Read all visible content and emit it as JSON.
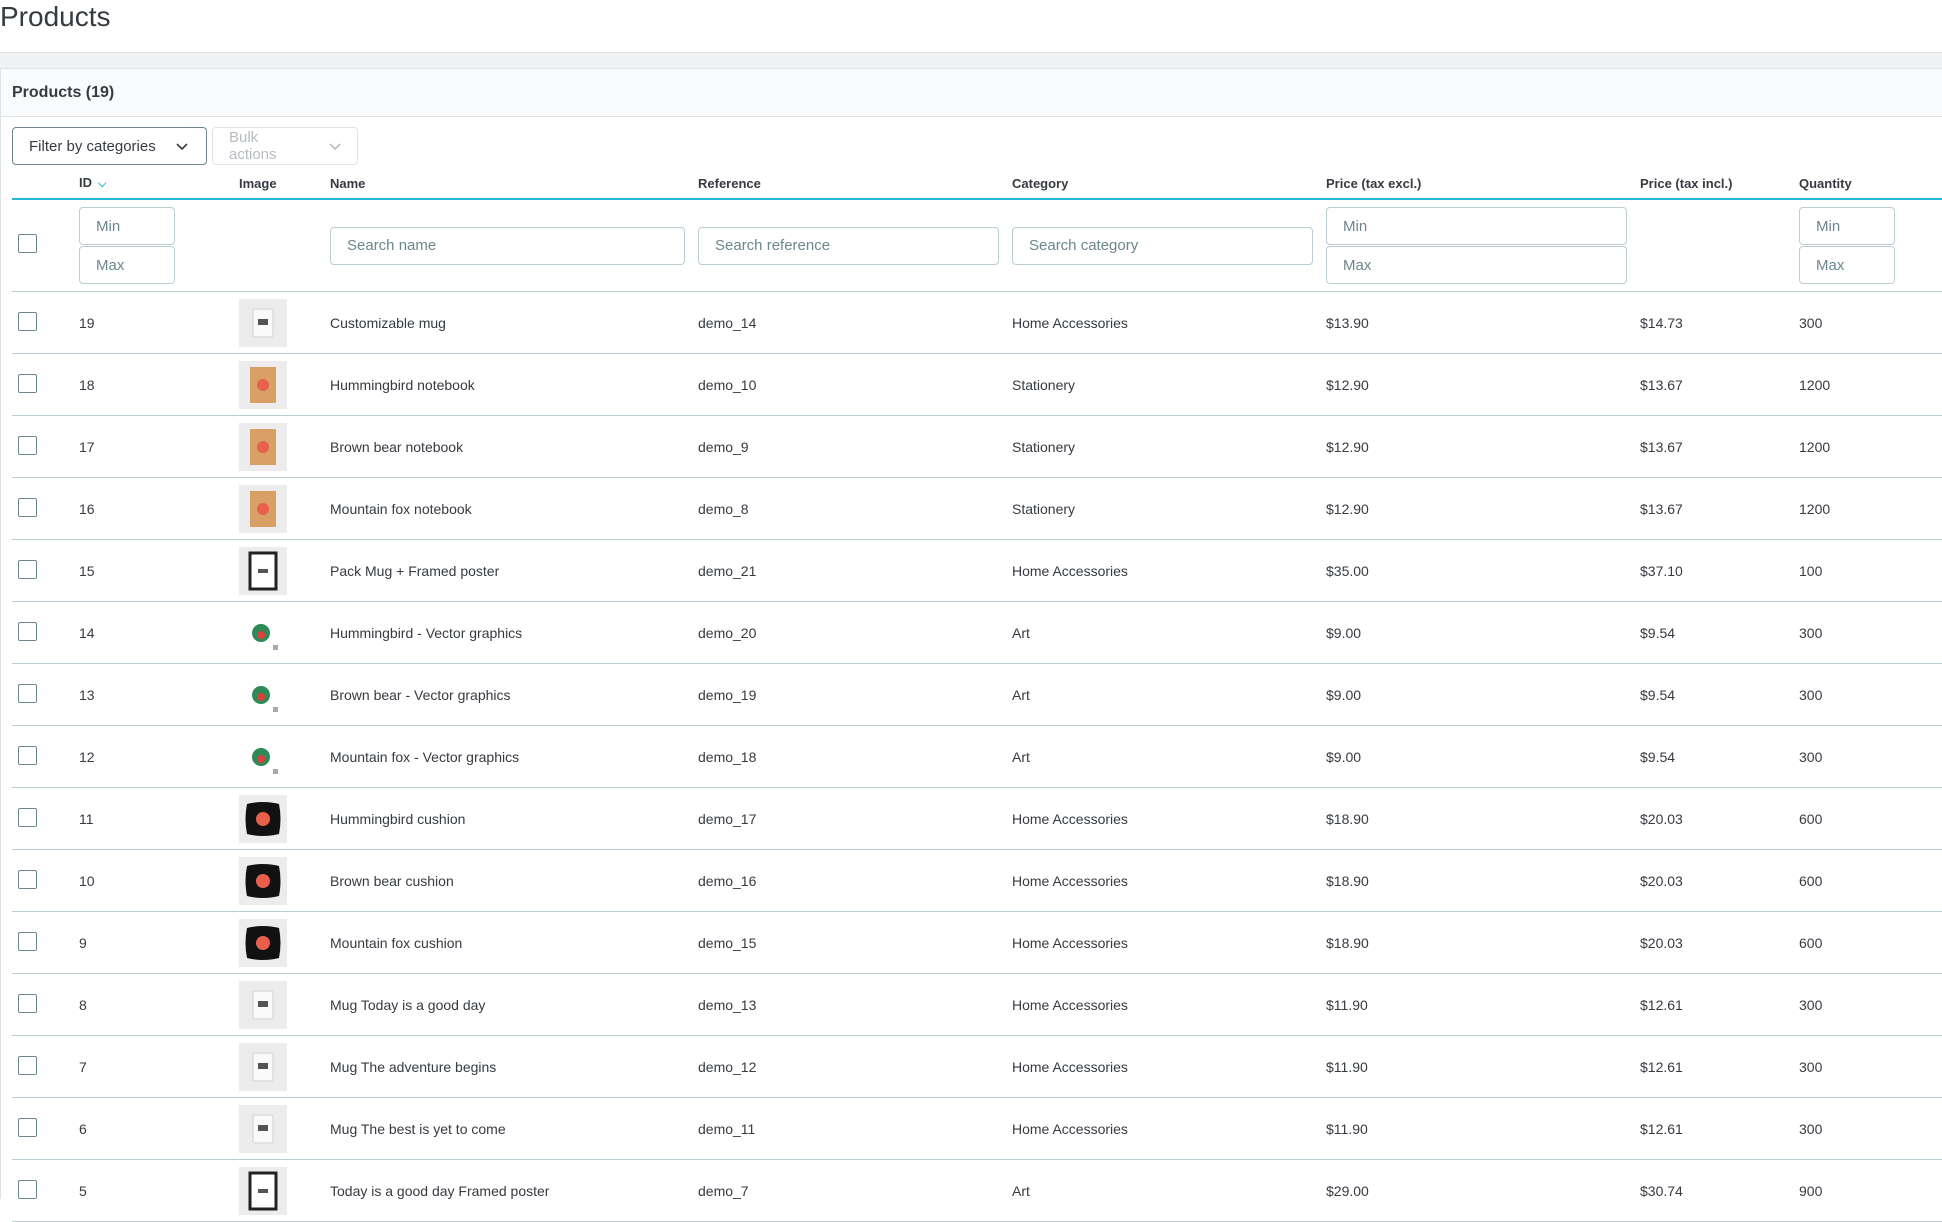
{
  "page": {
    "title": "Products"
  },
  "card": {
    "title": "Products (19)"
  },
  "toolbar": {
    "filter_label": "Filter by categories",
    "bulk_label": "Bulk actions"
  },
  "columns": {
    "id": "ID",
    "image": "Image",
    "name": "Name",
    "reference": "Reference",
    "category": "Category",
    "price_excl": "Price (tax excl.)",
    "price_incl": "Price (tax incl.)",
    "quantity": "Quantity"
  },
  "filters": {
    "id_min": "Min",
    "id_max": "Max",
    "name": "Search name",
    "reference": "Search reference",
    "category": "Search category",
    "price_min": "Min",
    "price_max": "Max",
    "qty_min": "Min",
    "qty_max": "Max"
  },
  "colors": {
    "accent": "#25b9d7",
    "text": "#363a41",
    "border": "#bbcdd2"
  },
  "products": [
    {
      "id": "19",
      "thumb": "mug",
      "name": "Customizable mug",
      "reference": "demo_14",
      "category": "Home Accessories",
      "price_excl": "$13.90",
      "price_incl": "$14.73",
      "quantity": "300"
    },
    {
      "id": "18",
      "thumb": "notebook",
      "name": "Hummingbird notebook",
      "reference": "demo_10",
      "category": "Stationery",
      "price_excl": "$12.90",
      "price_incl": "$13.67",
      "quantity": "1200"
    },
    {
      "id": "17",
      "thumb": "notebook",
      "name": "Brown bear notebook",
      "reference": "demo_9",
      "category": "Stationery",
      "price_excl": "$12.90",
      "price_incl": "$13.67",
      "quantity": "1200"
    },
    {
      "id": "16",
      "thumb": "notebook",
      "name": "Mountain fox notebook",
      "reference": "demo_8",
      "category": "Stationery",
      "price_excl": "$12.90",
      "price_incl": "$13.67",
      "quantity": "1200"
    },
    {
      "id": "15",
      "thumb": "poster",
      "name": "Pack Mug + Framed poster",
      "reference": "demo_21",
      "category": "Home Accessories",
      "price_excl": "$35.00",
      "price_incl": "$37.10",
      "quantity": "100"
    },
    {
      "id": "14",
      "thumb": "vector",
      "name": "Hummingbird - Vector graphics",
      "reference": "demo_20",
      "category": "Art",
      "price_excl": "$9.00",
      "price_incl": "$9.54",
      "quantity": "300"
    },
    {
      "id": "13",
      "thumb": "vector",
      "name": "Brown bear - Vector graphics",
      "reference": "demo_19",
      "category": "Art",
      "price_excl": "$9.00",
      "price_incl": "$9.54",
      "quantity": "300"
    },
    {
      "id": "12",
      "thumb": "vector",
      "name": "Mountain fox - Vector graphics",
      "reference": "demo_18",
      "category": "Art",
      "price_excl": "$9.00",
      "price_incl": "$9.54",
      "quantity": "300"
    },
    {
      "id": "11",
      "thumb": "cushion",
      "name": "Hummingbird cushion",
      "reference": "demo_17",
      "category": "Home Accessories",
      "price_excl": "$18.90",
      "price_incl": "$20.03",
      "quantity": "600"
    },
    {
      "id": "10",
      "thumb": "cushion",
      "name": "Brown bear cushion",
      "reference": "demo_16",
      "category": "Home Accessories",
      "price_excl": "$18.90",
      "price_incl": "$20.03",
      "quantity": "600"
    },
    {
      "id": "9",
      "thumb": "cushion",
      "name": "Mountain fox cushion",
      "reference": "demo_15",
      "category": "Home Accessories",
      "price_excl": "$18.90",
      "price_incl": "$20.03",
      "quantity": "600"
    },
    {
      "id": "8",
      "thumb": "mug",
      "name": "Mug Today is a good day",
      "reference": "demo_13",
      "category": "Home Accessories",
      "price_excl": "$11.90",
      "price_incl": "$12.61",
      "quantity": "300"
    },
    {
      "id": "7",
      "thumb": "mug",
      "name": "Mug The adventure begins",
      "reference": "demo_12",
      "category": "Home Accessories",
      "price_excl": "$11.90",
      "price_incl": "$12.61",
      "quantity": "300"
    },
    {
      "id": "6",
      "thumb": "mug",
      "name": "Mug The best is yet to come",
      "reference": "demo_11",
      "category": "Home Accessories",
      "price_excl": "$11.90",
      "price_incl": "$12.61",
      "quantity": "300"
    },
    {
      "id": "5",
      "thumb": "poster",
      "name": "Today is a good day Framed poster",
      "reference": "demo_7",
      "category": "Art",
      "price_excl": "$29.00",
      "price_incl": "$30.74",
      "quantity": "900"
    }
  ]
}
